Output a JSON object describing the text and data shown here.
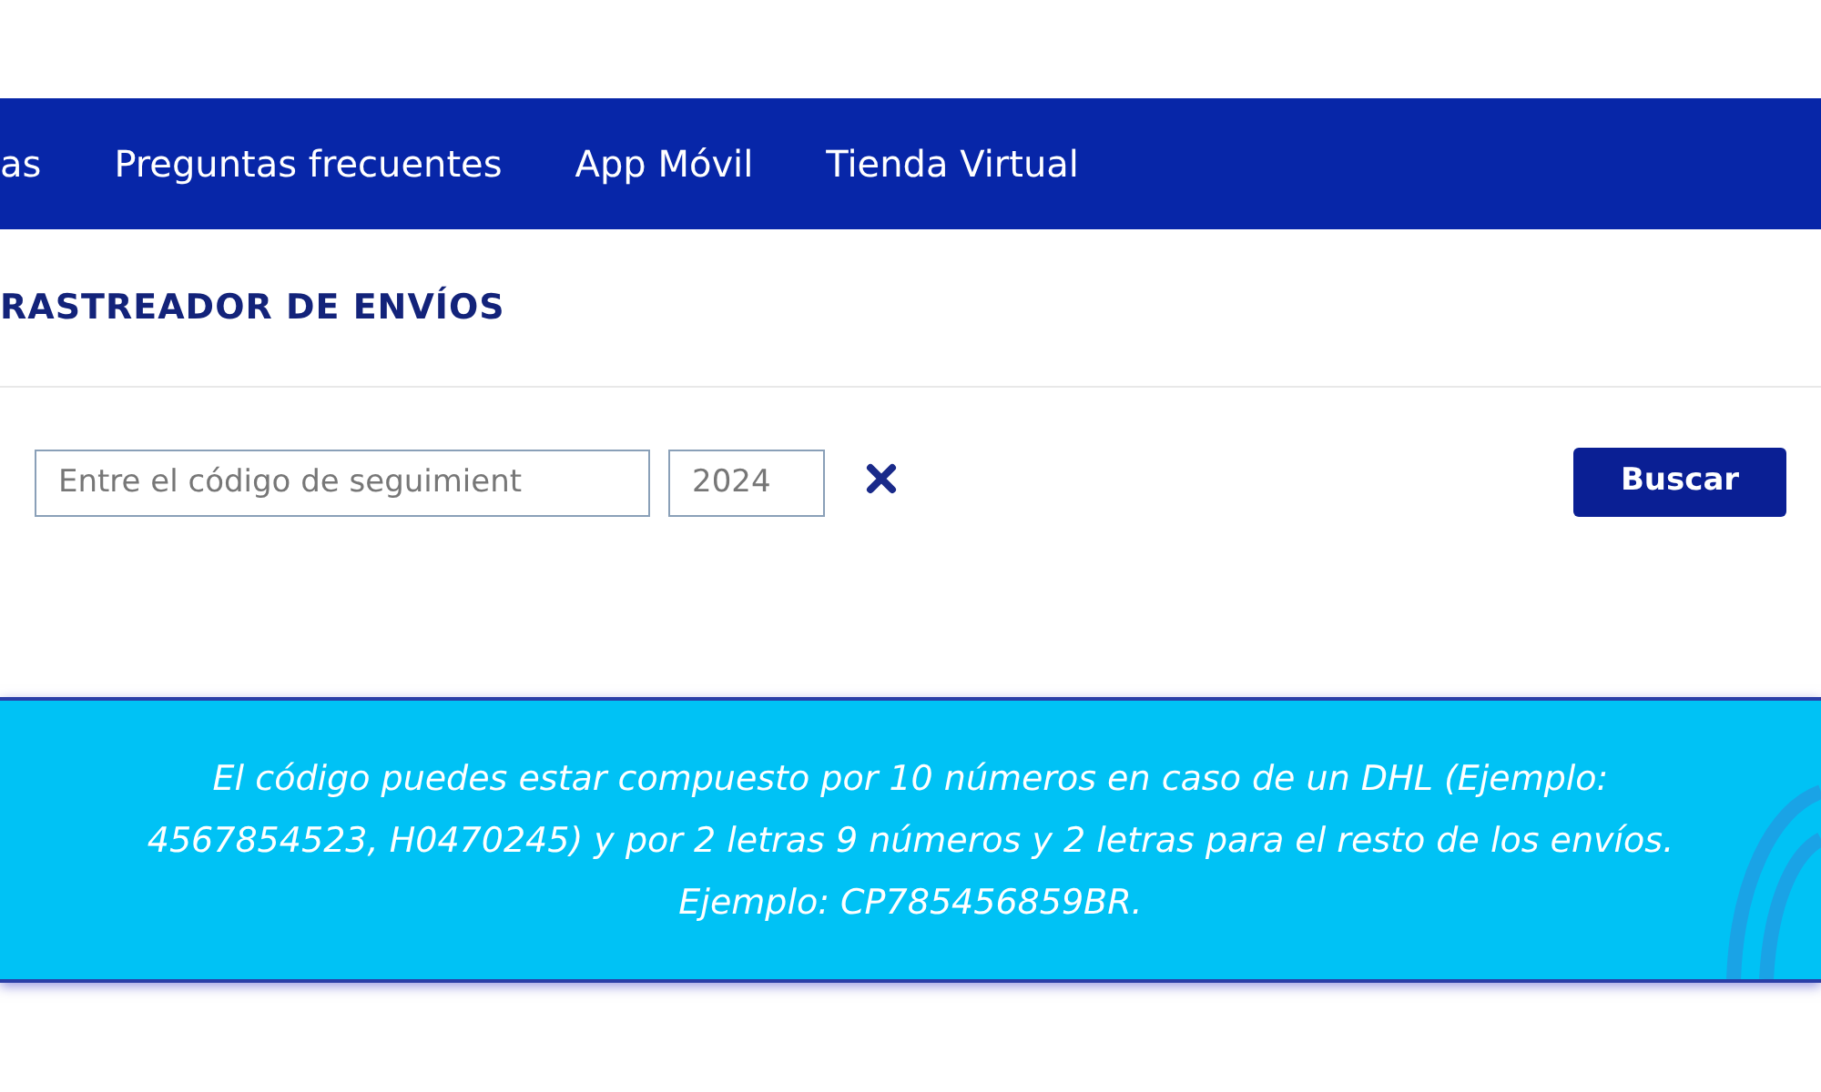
{
  "nav": {
    "items": [
      {
        "label": "as"
      },
      {
        "label": "Preguntas frecuentes"
      },
      {
        "label": "App Móvil"
      },
      {
        "label": "Tienda Virtual"
      }
    ]
  },
  "page_title": "RASTREADOR DE ENVÍOS",
  "search": {
    "code_field": {
      "placeholder": "Entre el código de seguimient"
    },
    "year_field": {
      "placeholder": "2024"
    },
    "button": "Buscar"
  },
  "info": "El código puedes estar compuesto por 10 números en caso de un DHL (Ejemplo: 4567854523, H0470245) y por 2 letras 9 números y 2 letras para el resto de los envíos. Ejemplo: CP785456859BR."
}
